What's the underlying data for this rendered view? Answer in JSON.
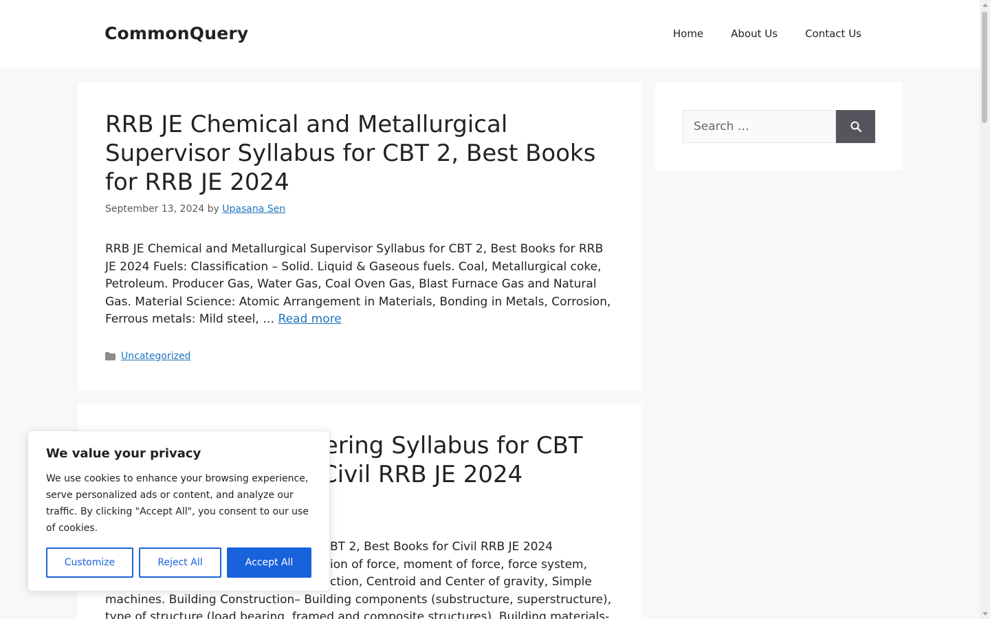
{
  "header": {
    "site_title": "CommonQuery",
    "nav": [
      "Home",
      "About Us",
      "Contact Us"
    ]
  },
  "articles": [
    {
      "title": "RRB JE Chemical and Metallurgical Supervisor Syllabus for CBT 2, Best Books for RRB JE 2024",
      "date": "September 13, 2024",
      "by": "by",
      "author": "Upasana Sen",
      "summary": "RRB JE Chemical and Metallurgical Supervisor Syllabus for CBT 2, Best Books for RRB JE 2024 Fuels: Classification – Solid. Liquid & Gaseous fuels. Coal, Metallurgical coke, Petroleum. Producer Gas, Water Gas, Coal Oven Gas, Blast Furnace Gas and Natural Gas. Material Science: Atomic Arrangement in Materials, Bonding in Metals, Corrosion, Ferrous metals: Mild steel, …",
      "read_more": "Read more",
      "category": "Uncategorized"
    },
    {
      "title_visible": "eering Syllabus for CBT\nCivil RRB JE 2024",
      "summary_line1": "BT 2, Best Books for Civil RRB JE 2024",
      "summary_line2": "ion of force, moment of force, force system,",
      "summary_line3": "ction, Centroid and Center of gravity, Simple",
      "summary_line4": "machines. Building Construction– Building components (substructure, superstructure),",
      "summary_line5": "type of structure (load bearing, framed and composite structures). Building materials-"
    }
  ],
  "sidebar": {
    "search_placeholder": "Search …"
  },
  "cookie": {
    "title": "We value your privacy",
    "text": "We use cookies to enhance your browsing experience, serve personalized ads or content, and analyze our traffic. By clicking \"Accept All\", you consent to our use of cookies.",
    "customize": "Customize",
    "reject": "Reject All",
    "accept": "Accept All"
  },
  "colors": {
    "accent_link": "#1e73be",
    "cookie_blue": "#1863dc",
    "search_button": "#55555e"
  },
  "icons": {
    "search": "search-icon",
    "category": "folder-icon"
  }
}
